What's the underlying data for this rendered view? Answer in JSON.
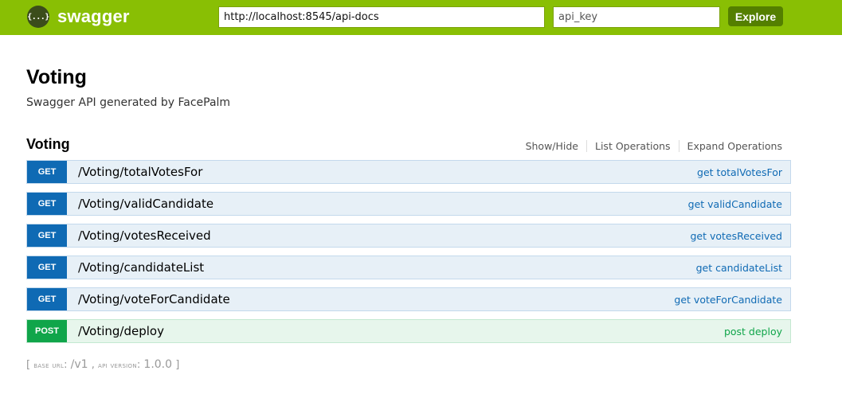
{
  "header": {
    "logo_icon": "{...}",
    "logo_text": "swagger",
    "url_value": "http://localhost:8545/api-docs",
    "api_key_placeholder": "api_key",
    "explore_label": "Explore",
    "bar_color": "#89bf04"
  },
  "info": {
    "title": "Voting",
    "description": "Swagger API generated by FacePalm"
  },
  "resource": {
    "name": "Voting",
    "links": [
      "Show/Hide",
      "List Operations",
      "Expand Operations"
    ],
    "operations": [
      {
        "method": "GET",
        "path": "/Voting/totalVotesFor",
        "summary": "get totalVotesFor"
      },
      {
        "method": "GET",
        "path": "/Voting/validCandidate",
        "summary": "get validCandidate"
      },
      {
        "method": "GET",
        "path": "/Voting/votesReceived",
        "summary": "get votesReceived"
      },
      {
        "method": "GET",
        "path": "/Voting/candidateList",
        "summary": "get candidateList"
      },
      {
        "method": "GET",
        "path": "/Voting/voteForCandidate",
        "summary": "get voteForCandidate"
      },
      {
        "method": "POST",
        "path": "/Voting/deploy",
        "summary": "post deploy"
      }
    ]
  },
  "footer": {
    "open": "[",
    "base_url_label": "base url",
    "base_url_value": "/v1",
    "sep": ",",
    "api_version_label": "api version",
    "api_version_value": "1.0.0",
    "close": "]"
  },
  "colors": {
    "get": "#0f6ab4",
    "post": "#10a54a"
  }
}
